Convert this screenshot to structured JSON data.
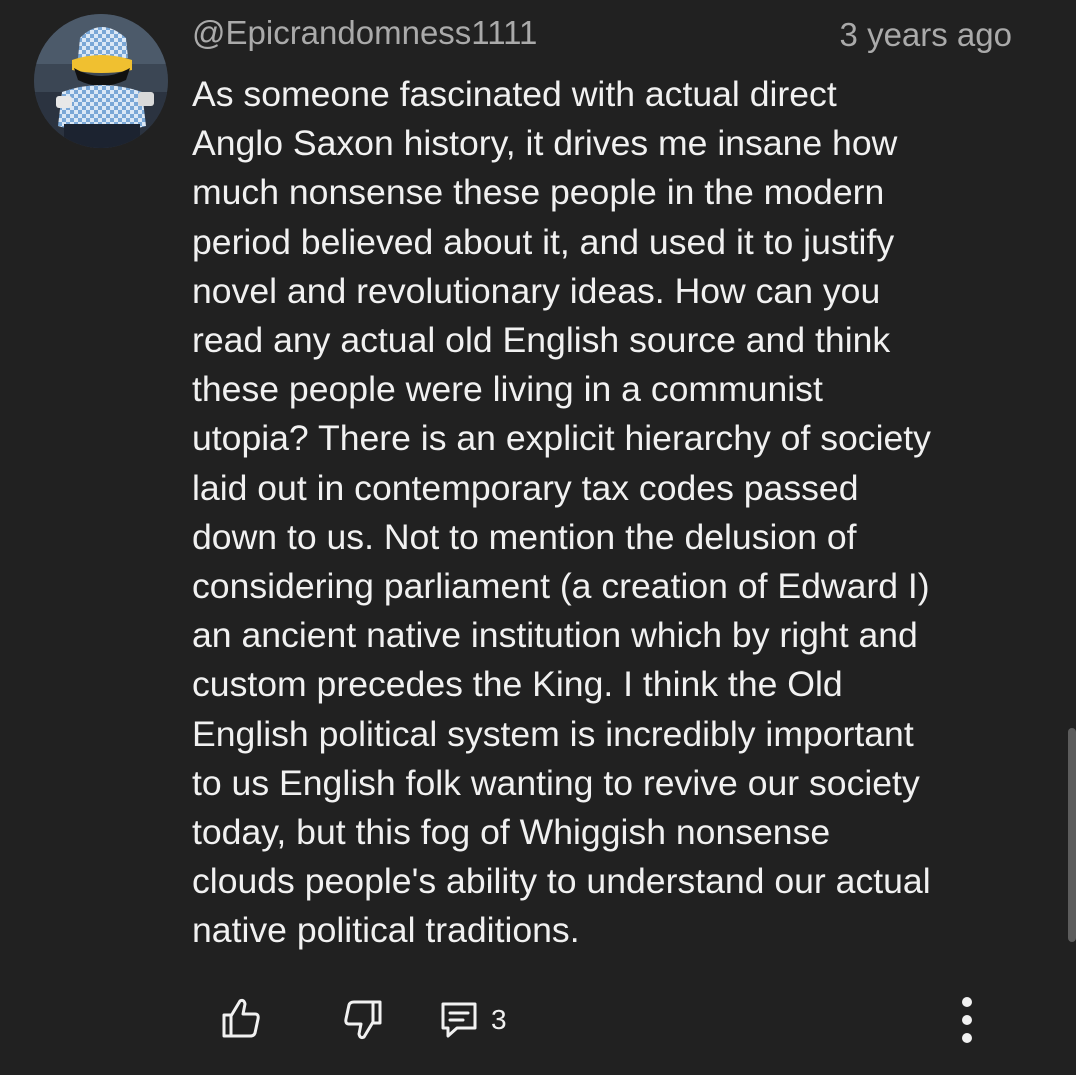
{
  "comment": {
    "author": "@Epicrandomness1111",
    "timestamp": "3 years ago",
    "text_lines": [
      "As someone fascinated with actual direct",
      "Anglo Saxon history, it drives me insane how",
      "much nonsense these people in the modern",
      "period believed about it, and used it to justify",
      "novel and revolutionary ideas. How can you",
      "read any actual old English source and think",
      "these people were living in a communist",
      "utopia? There is an explicit hierarchy of society",
      "laid out in contemporary tax codes passed",
      "down to us. Not to mention the delusion of",
      "considering parliament (a creation of Edward I)",
      "an ancient native institution which by right and",
      "custom precedes the King. I think the Old",
      "English political system is incredibly important",
      "to us English folk wanting to revive our society",
      "today, but this fog of Whiggish nonsense",
      "clouds people's ability to understand our actual",
      "native political traditions."
    ],
    "actions": {
      "like_icon": "thumb-up-icon",
      "dislike_icon": "thumb-down-icon",
      "reply_icon": "comment-icon",
      "reply_count": "3",
      "more_icon": "more-vertical-icon"
    }
  },
  "colors": {
    "background": "#212121",
    "text": "#f1f1f1",
    "secondary_text": "#aaaaaa"
  }
}
